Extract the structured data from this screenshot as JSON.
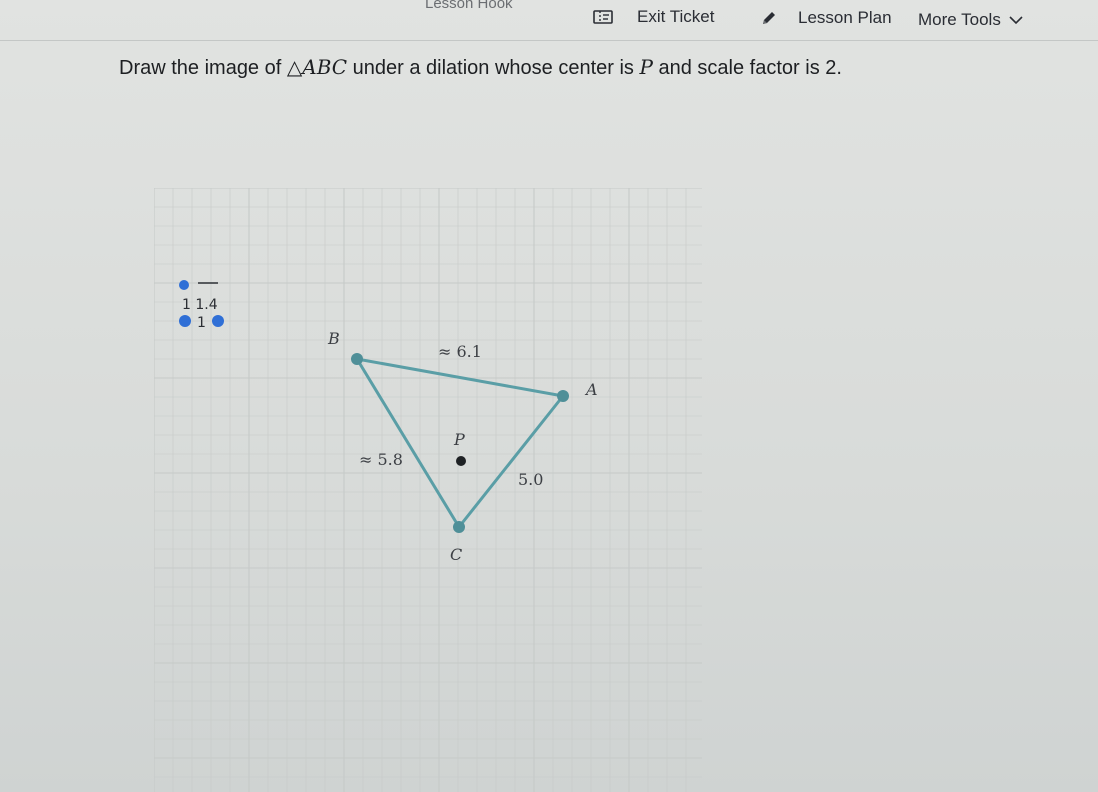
{
  "toolbar": {
    "lesson_hook_label": "Lesson Hook",
    "exit_ticket_label": "Exit Ticket",
    "lesson_plan_label": "Lesson Plan",
    "more_tools_label": "More Tools"
  },
  "question": {
    "part1": "Draw the image of ",
    "triangle_symbol": "△",
    "triangle_name": "ABC",
    "part2": " under a dilation whose center is ",
    "center_name": "P",
    "part3": " and scale factor is 2."
  },
  "tool_cluster": {
    "top_label": "1 1.4",
    "bottom_label": "1"
  },
  "figure": {
    "vertex_labels": {
      "A": "A",
      "B": "B",
      "C": "C",
      "P": "P"
    },
    "side_labels": {
      "AB": "≈ 6.1",
      "BC": "≈ 5.8",
      "AC": "5.0"
    },
    "colors": {
      "triangle_stroke": "#5a9ea6",
      "vertex_fill": "#4f8f98",
      "center_fill": "#1e2124",
      "grid_line": "#c6cac8",
      "tool_dot": "#2f6fd6"
    }
  }
}
